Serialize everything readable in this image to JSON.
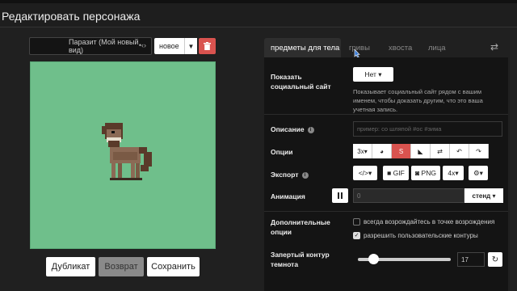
{
  "window": {
    "title": "Редактировать персонажа"
  },
  "character": {
    "selected": "Паразит (Мой новый вид)",
    "new_label": "новое",
    "preview_bg": "#6fbf8b"
  },
  "actions": {
    "duplicate": "Дубликат",
    "revert": "Возврат",
    "save": "Сохранить"
  },
  "tabs": [
    {
      "label": "предметы для тела",
      "active": true
    },
    {
      "label": "гривы"
    },
    {
      "label": "хвоста"
    },
    {
      "label": "лица"
    }
  ],
  "settings": {
    "show_site": {
      "label": "Показать социальный сайт",
      "value": "Нет",
      "help": "Показывает социальный сайт рядом с вашим именем, чтобы доказать другим, что это ваша учетная запись."
    },
    "description": {
      "label": "Описание",
      "placeholder": "пример: со шляпой #ос #зима"
    },
    "options": {
      "label": "Опции",
      "scale": "3x"
    },
    "export": {
      "label": "Экспорт",
      "gif": "GIF",
      "png": "PNG",
      "scale": "4x"
    },
    "animation": {
      "label": "Анимация",
      "value": "0",
      "mode": "стенд"
    },
    "extra": {
      "label": "Дополнительные опции",
      "items": [
        {
          "label": "всегда возрождайтесь в точке возрождения",
          "checked": false
        },
        {
          "label": "разрешить пользовательские контуры",
          "checked": true
        }
      ]
    },
    "outline": {
      "label": "Запертый контур темнота",
      "value": "17",
      "level": 0.12
    }
  },
  "colors": {
    "accent_red": "#d9534f"
  }
}
